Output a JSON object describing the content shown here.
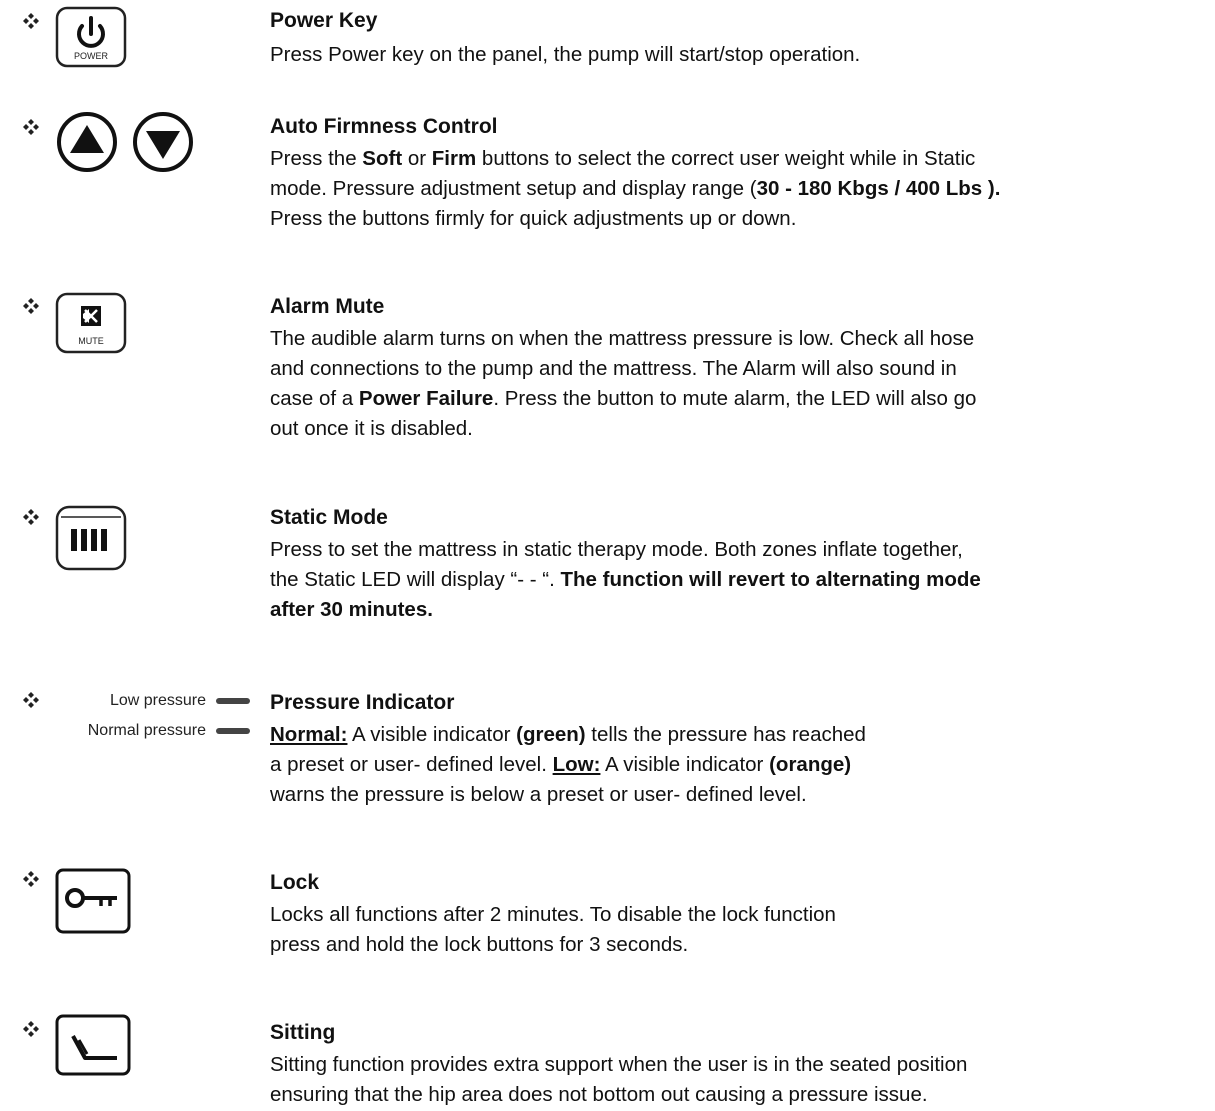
{
  "sections": {
    "power": {
      "icon_label": "POWER",
      "title": "Power Key",
      "line1": "Press Power key on the panel, the pump will start/stop operation."
    },
    "firmness": {
      "title": "Auto Firmness Control",
      "p1_pre": "Press the ",
      "p1_soft": "Soft",
      "p1_or": " or ",
      "p1_firm": "Firm",
      "p1_post": " buttons to select the correct user weight while in Static",
      "p2_pre": "mode. Pressure adjustment setup and display range (",
      "p2_range": "30 - 180 Kbgs / 400 Lbs ).",
      "p3": "Press the buttons firmly for quick adjustments up or down."
    },
    "mute": {
      "icon_label": "MUTE",
      "title": "Alarm Mute",
      "l1": "The audible alarm turns on when the mattress pressure is low. Check all hose",
      "l2": "and connections to the pump and the mattress.  The Alarm will also sound in",
      "l3_pre": "case of a ",
      "l3_bold": "Power Failure",
      "l3_post": ". Press the button to mute alarm, the LED will also go",
      "l4": "out once it is disabled."
    },
    "static": {
      "title": "Static Mode",
      "l1": "Press to set the mattress in static therapy mode. Both zones inflate together,",
      "l2_pre": "the Static LED will display “- - “.  ",
      "l2_bold": "The function will revert to alternating mode",
      "l3_bold": "after 30 minutes."
    },
    "pressure": {
      "low_label": "Low pressure",
      "normal_label": "Normal pressure",
      "title": "Pressure Indicator",
      "l1_u": "Normal:",
      "l1_pre": " A visible indicator ",
      "l1_bold": "(green)",
      "l1_post": " tells the pressure has reached",
      "l2_pre": "a preset or user- defined level. ",
      "l2_u": "Low:",
      "l2_mid": " A visible indicator ",
      "l2_bold": "(orange)",
      "l3": "warns the pressure is below a preset or user- defined level."
    },
    "lock": {
      "title": "Lock",
      "l1": "Locks all functions after 2 minutes. To disable the lock function",
      "l2": "press and hold the lock buttons for 3 seconds."
    },
    "sitting": {
      "title": "Sitting",
      "l1": "Sitting function provides extra support when the user is in the seated position",
      "l2": "ensuring that the hip area does not bottom out causing a pressure issue."
    }
  }
}
